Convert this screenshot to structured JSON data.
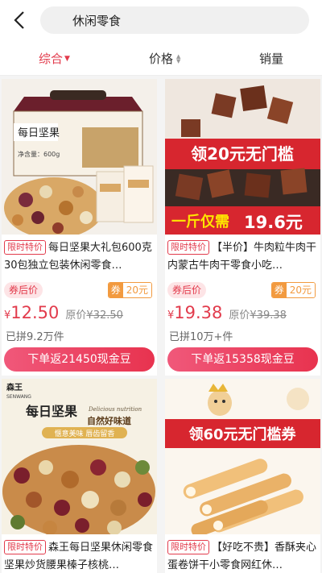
{
  "search": {
    "query": "休闲零食"
  },
  "tabs": [
    {
      "label": "综合",
      "active": true,
      "indicator": "caret-down-icon"
    },
    {
      "label": "价格",
      "active": false,
      "indicator": "sort-icon"
    },
    {
      "label": "销量",
      "active": false,
      "indicator": ""
    }
  ],
  "colors": {
    "accent": "#e23b4c",
    "coupon": "#f29a3f",
    "button": "#e8334f"
  },
  "products": [
    {
      "badge": "限时特价",
      "title": "每日坚果大礼包600克 30包独立包装休闲零食…",
      "after_coupon": "券后价",
      "coupon_tag": "券",
      "coupon_value": "20元",
      "currency": "¥",
      "price": "12.50",
      "orig_label": "原价",
      "orig_price": "¥32.50",
      "sold": "已拼9.2万件",
      "cashback": "下单返21450现金豆",
      "image_text": {
        "box_brand": "每日坚果",
        "box_label": "净含量：600g"
      }
    },
    {
      "badge": "限时特价",
      "title": "【半价】牛肉粒牛肉干内蒙古牛肉干零食小吃…",
      "after_coupon": "券后价",
      "coupon_tag": "券",
      "coupon_value": "20元",
      "currency": "¥",
      "price": "19.38",
      "orig_label": "原价",
      "orig_price": "¥39.38",
      "sold": "已拼10万+件",
      "cashback": "下单返15358现金豆",
      "image_text": {
        "banner": "领20元无门槛",
        "promo_prefix": "一斤仅需",
        "promo_price": "19.6元"
      }
    },
    {
      "badge": "限时特价",
      "title": "森王每日坚果休闲零食坚果炒货腰果榛子核桃…",
      "image_text": {
        "brand": "森王",
        "brand_en": "SENWANG",
        "headline": "每日坚果",
        "sub1": "自然好味道",
        "sub2": "惬意美味 唇齿留香",
        "en": "Delicious nutrition"
      }
    },
    {
      "badge": "限时特价",
      "title": "【好吃不贵】香酥夹心蛋卷饼干小零食网红休…",
      "image_text": {
        "banner": "领60元无门槛券"
      }
    }
  ]
}
